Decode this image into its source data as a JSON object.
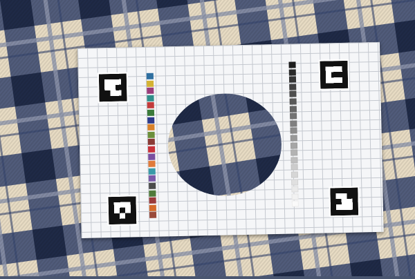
{
  "scene": {
    "background": "plaid blanket",
    "plaid_colors": {
      "base": "#e8dcc4",
      "band": "#36456e",
      "dark": "#1f2a47",
      "thread": "#8e96ad"
    }
  },
  "card": {
    "paper_color": "#f5f6f8",
    "grid_color": "#c4c8cf",
    "fiducial_markers": [
      {
        "name": "marker-top-left",
        "pattern": [
          "11111",
          "10001",
          "10011",
          "11001",
          "11111"
        ]
      },
      {
        "name": "marker-top-right",
        "pattern": [
          "11111",
          "10001",
          "10111",
          "10001",
          "11111"
        ]
      },
      {
        "name": "marker-bottom-left",
        "pattern": [
          "11111",
          "10001",
          "10101",
          "11011",
          "11111"
        ]
      },
      {
        "name": "marker-bottom-right",
        "pattern": [
          "11111",
          "10011",
          "11001",
          "10001",
          "11111"
        ]
      }
    ],
    "color_swatches": [
      "#2f6fa0",
      "#d4b233",
      "#9a3d7a",
      "#2f8f8a",
      "#c23b3b",
      "#3b7a3a",
      "#2d3a8a",
      "#d9822b",
      "#6b8f3a",
      "#8a3a35",
      "#c8323a",
      "#7a4fa0",
      "#e07a3a",
      "#3a9aa8",
      "#7a5aa8",
      "#4a4a4a",
      "#4f7a3a",
      "#9a3a3a",
      "#d46a2a",
      "#9a4a3a"
    ],
    "gray_ramp": [
      "#1e1e1e",
      "#2a2a2a",
      "#363636",
      "#424242",
      "#4e4e4e",
      "#5a5a5a",
      "#666666",
      "#737373",
      "#808080",
      "#8c8c8c",
      "#999999",
      "#a6a6a6",
      "#b3b3b3",
      "#bfbfbf",
      "#cccccc",
      "#d6d6d6",
      "#e0e0e0",
      "#eaeaea",
      "#f2f2f2",
      "#fafafa"
    ]
  }
}
